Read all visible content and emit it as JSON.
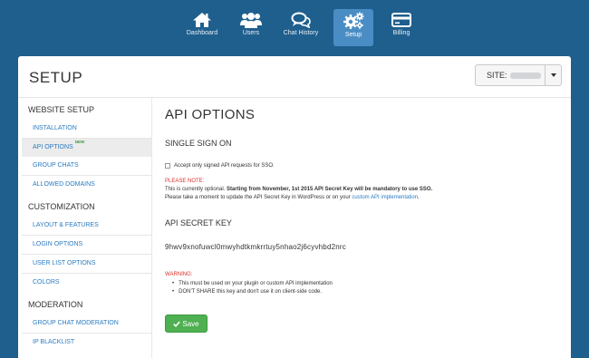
{
  "nav": {
    "items": [
      {
        "label": "Dashboard",
        "icon": "home-icon"
      },
      {
        "label": "Users",
        "icon": "users-icon"
      },
      {
        "label": "Chat History",
        "icon": "chat-history-icon"
      },
      {
        "label": "Setup",
        "icon": "gears-icon",
        "active": true
      },
      {
        "label": "Billing",
        "icon": "credit-card-icon"
      }
    ]
  },
  "header": {
    "title": "SETUP",
    "site_label": "SITE:"
  },
  "sidebar": {
    "sections": [
      {
        "title": "WEBSITE SETUP",
        "items": [
          "INSTALLATION",
          "API OPTIONS",
          "GROUP CHATS",
          "ALLOWED DOMAINS"
        ]
      },
      {
        "title": "CUSTOMIZATION",
        "items": [
          "LAYOUT & FEATURES",
          "LOGIN OPTIONS",
          "USER LIST OPTIONS",
          "COLORS"
        ]
      },
      {
        "title": "MODERATION",
        "items": [
          "GROUP CHAT MODERATION",
          "IP BLACKLIST"
        ]
      }
    ],
    "active_item": "API OPTIONS",
    "new_badge": "NEW"
  },
  "main": {
    "title": "API OPTIONS",
    "sso": {
      "heading": "SINGLE SIGN ON",
      "checkbox_label": "Accept only signed API requests for SSO.",
      "checked": false
    },
    "note": {
      "title": "PLEASE NOTE:",
      "line1_start": "This is currently optional. ",
      "line1_bold": "Starting from November, 1st 2015 API Secret Key will be mandatory to use SSO.",
      "line2_start": "Please take a moment to update the API Secret Key in WordPress or on your ",
      "line2_link": "custom API implementation",
      "line2_end": "."
    },
    "secret": {
      "heading": "API SECRET KEY",
      "key": "9hwv9xnofuwcl0mwyhdtkmkrrtuy5nhao2j6cyvhbd2nrc"
    },
    "warning": {
      "title": "WARNING:",
      "items": [
        "This must be used on your plugin or custom API implementation",
        "DON'T SHARE this key and don't use it on client-side code."
      ]
    },
    "save_label": "Save"
  },
  "colors": {
    "topbar": "#1f5f8e",
    "active_nav": "#4a8dc4",
    "link": "#2b7bc0",
    "warning": "#d9302c",
    "save": "#4eb051"
  }
}
